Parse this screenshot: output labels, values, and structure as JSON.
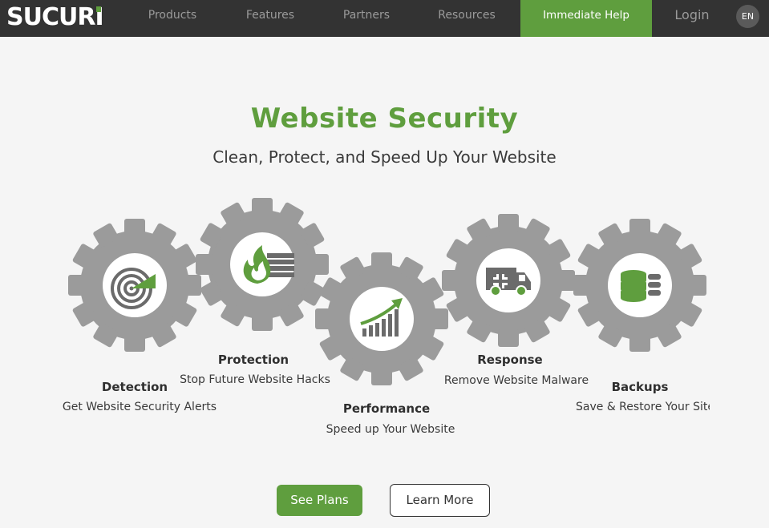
{
  "header": {
    "logo_text": "SUCURI",
    "nav": {
      "products": "Products",
      "features": "Features",
      "partners": "Partners",
      "resources": "Resources",
      "immediate_help": "Immediate Help",
      "login": "Login",
      "language": "EN"
    }
  },
  "hero": {
    "title": "Website Security",
    "subtitle": "Clean, Protect, and Speed Up Your Website"
  },
  "features": {
    "detection": {
      "label": "Detection",
      "desc": "Get Website Security Alerts",
      "icon": "radar-icon"
    },
    "protection": {
      "label": "Protection",
      "desc": "Stop Future Website Hacks",
      "icon": "firewall-icon"
    },
    "performance": {
      "label": "Performance",
      "desc": "Speed up Your Website",
      "icon": "growth-chart-icon"
    },
    "response": {
      "label": "Response",
      "desc": "Remove Website Malware",
      "icon": "ambulance-icon"
    },
    "backups": {
      "label": "Backups",
      "desc": "Save & Restore Your Site",
      "icon": "database-icon"
    }
  },
  "cta": {
    "see_plans": "See Plans",
    "learn_more": "Learn More"
  },
  "colors": {
    "brand_green": "#5f9e3e",
    "gear_gray": "#9b9b9b",
    "header_bg": "#333333"
  }
}
